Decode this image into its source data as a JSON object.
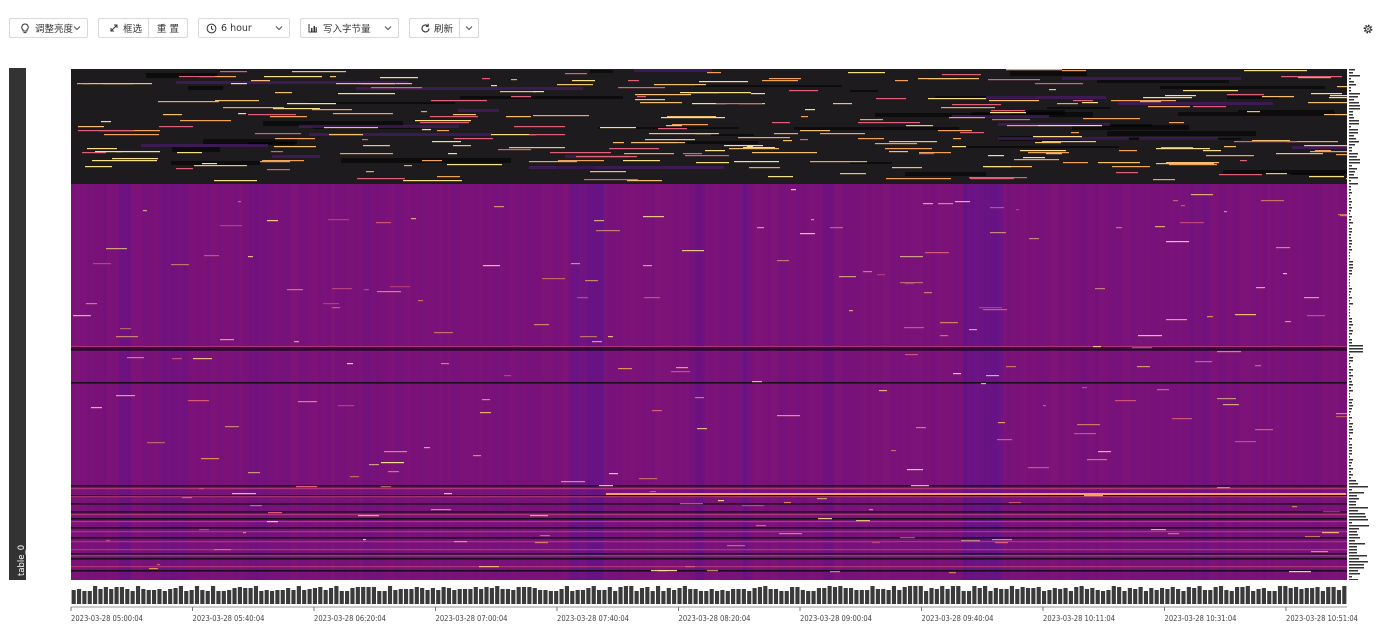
{
  "toolbar": {
    "brightness_label": "调整亮度",
    "select_label": "框选",
    "reset_label": "重 置",
    "time_range_label": "6 hour",
    "metric_label": "写入字节量",
    "refresh_label": "刷新"
  },
  "icons": {
    "brightness": "bulb-icon",
    "select": "expand-arrows-icon",
    "time": "clock-icon",
    "metric": "bar-chart-icon",
    "refresh": "refresh-icon",
    "settings": "gear-icon"
  },
  "sidebar": {
    "table_label": "table_0"
  },
  "colors": {
    "dark_band": "#1d1b1d",
    "base_purple": "#7a1279",
    "deep_purple": "#5a1490",
    "hot_orange": "#f2a25a",
    "hot_yellow": "#f8e08a",
    "bar_gray": "#3a3a3a"
  },
  "chart_data": {
    "type": "heatmap",
    "title": "",
    "xlabel": "",
    "ylabel": "",
    "x_ticks": [
      "2023-03-28 05:00:04",
      "2023-03-28 05:40:04",
      "2023-03-28 06:20:04",
      "2023-03-28 07:00:04",
      "2023-03-28 07:40:04",
      "2023-03-28 08:20:04",
      "2023-03-28 09:00:04",
      "2023-03-28 09:40:04",
      "2023-03-28 10:11:04",
      "2023-03-28 10:31:04",
      "2023-03-28 10:51:04"
    ],
    "y_category": "table_0",
    "colormap": "magma"
  }
}
